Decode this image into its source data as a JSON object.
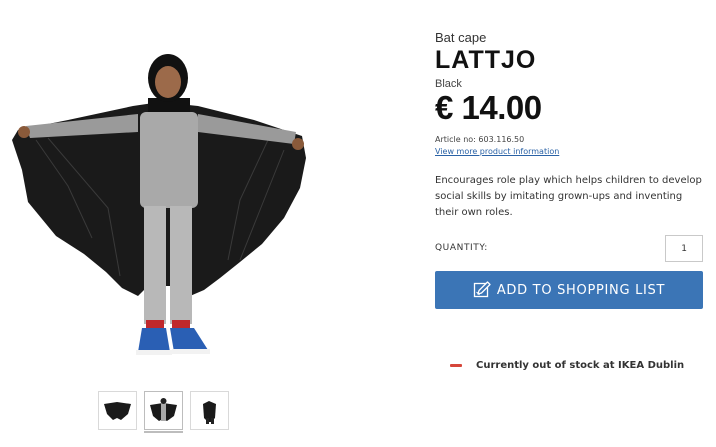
{
  "product": {
    "type": "Bat cape",
    "name": "LATTJO",
    "color": "Black",
    "price": "€ 14.00",
    "article": "Article no: 603.116.50",
    "more_info": "View more product information",
    "description": "Encourages role play which helps children to develop social skills by imitating grown-ups and inventing their own roles."
  },
  "purchase": {
    "quantity_label": "QUANTITY:",
    "quantity_value": "1",
    "add_button_label": "ADD TO SHOPPING LIST",
    "add_button_icon": "pencil-list-icon"
  },
  "stock": {
    "status_icon": "out-of-stock-dash-icon",
    "status_text": "Currently out of stock at IKEA Dublin",
    "status_color": "#d6463a"
  },
  "gallery": {
    "main_image": "child-wearing-bat-cape",
    "thumbnails": [
      "cape-flat-thumbnail",
      "child-in-cape-thumbnail",
      "cape-on-hanger-thumbnail"
    ],
    "selected_thumbnail": 1
  },
  "colors": {
    "button": "#3b75b6",
    "link": "#2a62a6"
  }
}
